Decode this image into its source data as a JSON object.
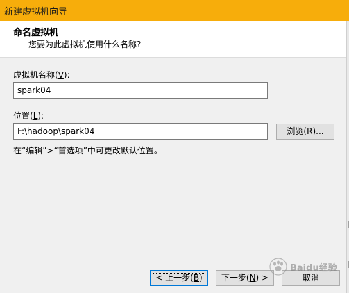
{
  "window": {
    "title": "新建虚拟机向导"
  },
  "header": {
    "title": "命名虚拟机",
    "subtitle": "您要为此虚拟机使用什么名称?"
  },
  "form": {
    "name_label_prefix": "虚拟机名称(",
    "name_label_key": "V",
    "name_label_suffix": "):",
    "name_value": "spark04",
    "location_label_prefix": "位置(",
    "location_label_key": "L",
    "location_label_suffix": "):",
    "location_value": "F:\\hadoop\\spark04",
    "browse_prefix": "浏览(",
    "browse_key": "R",
    "browse_suffix": ")...",
    "hint": "在“编辑”>“首选项”中可更改默认位置。"
  },
  "footer": {
    "back_prefix": "< 上一步(",
    "back_key": "B",
    "back_suffix": ")",
    "next_prefix": "下一步(",
    "next_key": "N",
    "next_suffix": ") >",
    "cancel": "取消"
  },
  "watermark": {
    "text": "Baidu经验"
  },
  "colors": {
    "titlebar": "#f7ad0b",
    "focus_border": "#0078d7"
  }
}
